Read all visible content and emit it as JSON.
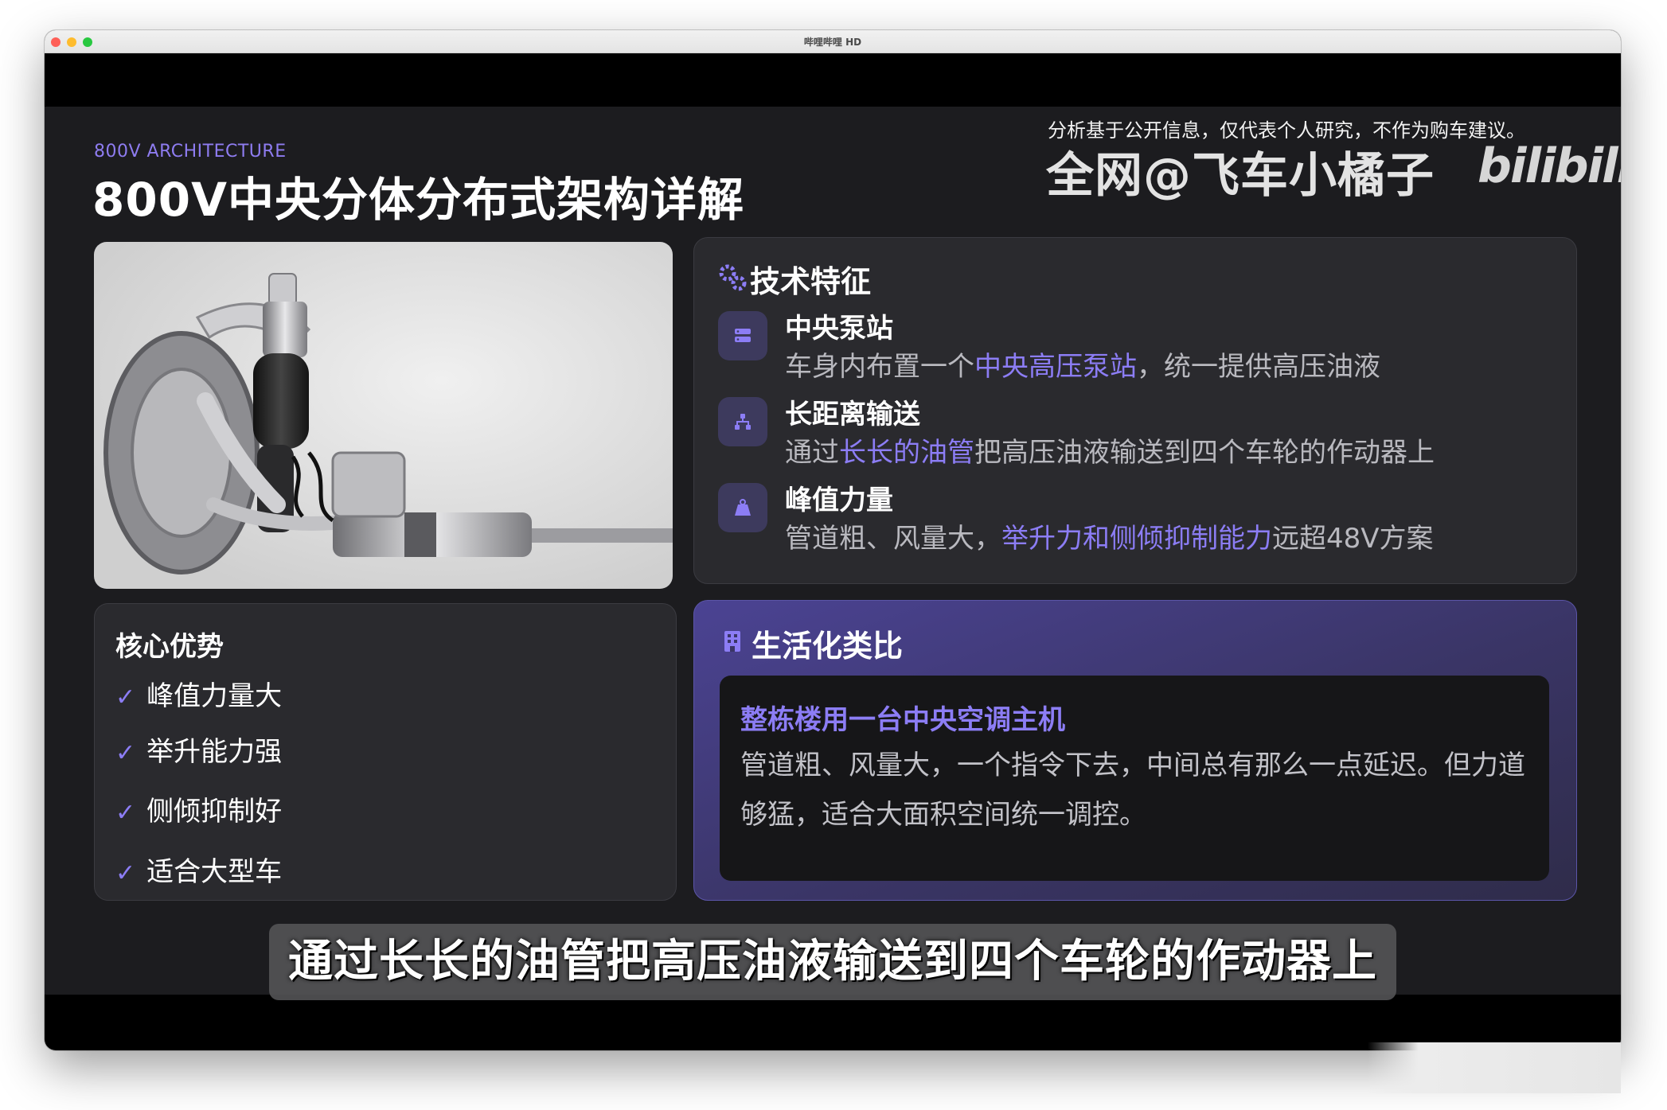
{
  "window": {
    "title": "哔哩哔哩 HD"
  },
  "slide": {
    "eyebrow": "800V ARCHITECTURE",
    "title": "800V中央分体分布式架构详解",
    "disclaimer": "分析基于公开信息，仅代表个人研究，不作为购车建议。",
    "watermark": "全网@飞车小橘子",
    "watermark_logo": "bilibili"
  },
  "features": {
    "title": "技术特征",
    "items": [
      {
        "icon": "server-icon",
        "name": "中央泵站",
        "desc_pre": "车身内布置一个",
        "desc_hl": "中央高压泵站",
        "desc_post": "，统一提供高压油液"
      },
      {
        "icon": "network-icon",
        "name": "长距离输送",
        "desc_pre": "通过",
        "desc_hl": "长长的油管",
        "desc_post": "把高压油液输送到四个车轮的作动器上"
      },
      {
        "icon": "weight-icon",
        "name": "峰值力量",
        "desc_pre": "管道粗、风量大，",
        "desc_hl": "举升力和侧倾抑制能力",
        "desc_post": "远超48V方案"
      }
    ]
  },
  "core": {
    "title": "核心优势",
    "items": [
      "峰值力量大",
      "举升能力强",
      "侧倾抑制好",
      "适合大型车"
    ]
  },
  "analogy": {
    "title": "生活化类比",
    "heading": "整栋楼用一台中央空调主机",
    "body": "管道粗、风量大，一个指令下去，中间总有那么一点延迟。但力道够猛，适合大面积空间统一调控。"
  },
  "subtitle": "通过长长的油管把高压油液输送到四个车轮的作动器上",
  "colors": {
    "accent": "#8c7df5",
    "card": "#2a2a2e",
    "background": "#1c1c1f"
  }
}
